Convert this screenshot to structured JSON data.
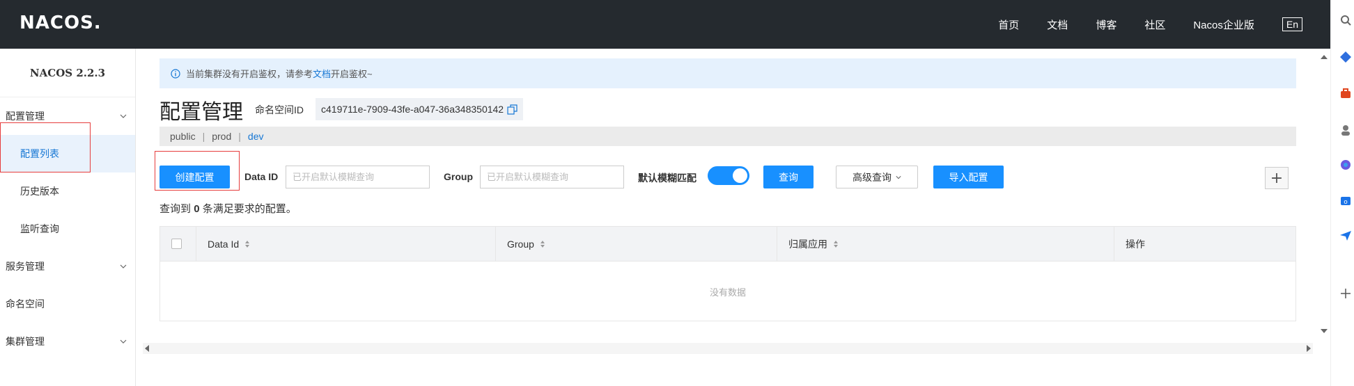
{
  "header": {
    "logo": "NACOS.",
    "nav": [
      "首页",
      "文档",
      "博客",
      "社区",
      "Nacos企业版"
    ],
    "lang": "En"
  },
  "sidebar": {
    "version": "NACOS 2.2.3",
    "groups": [
      {
        "label": "配置管理",
        "items": [
          "配置列表",
          "历史版本",
          "监听查询"
        ]
      },
      {
        "label": "服务管理"
      },
      {
        "label": "命名空间"
      },
      {
        "label": "集群管理"
      }
    ]
  },
  "notice": {
    "prefix": "当前集群没有开启鉴权，请参考",
    "link": "文档",
    "suffix": "开启鉴权~"
  },
  "page": {
    "title": "配置管理",
    "ns_label": "命名空间ID",
    "ns_id": "c419711e-7909-43fe-a047-36a348350142",
    "ns_tabs": [
      "public",
      "prod",
      "dev"
    ]
  },
  "toolbar": {
    "create": "创建配置",
    "dataid_label": "Data ID",
    "dataid_placeholder": "已开启默认模糊查询",
    "group_label": "Group",
    "group_placeholder": "已开启默认模糊查询",
    "fuzzy_label": "默认模糊匹配",
    "query": "查询",
    "advanced": "高级查询",
    "import": "导入配置",
    "plus": "+"
  },
  "result": {
    "prefix": "查询到",
    "count": "0",
    "suffix": "条满足要求的配置。"
  },
  "table": {
    "columns": [
      "Data Id",
      "Group",
      "归属应用",
      "操作"
    ],
    "empty": "没有数据"
  },
  "colors": {
    "primary": "#1890ff",
    "header_bg": "#252a2f",
    "highlight": "#e63c3c"
  }
}
